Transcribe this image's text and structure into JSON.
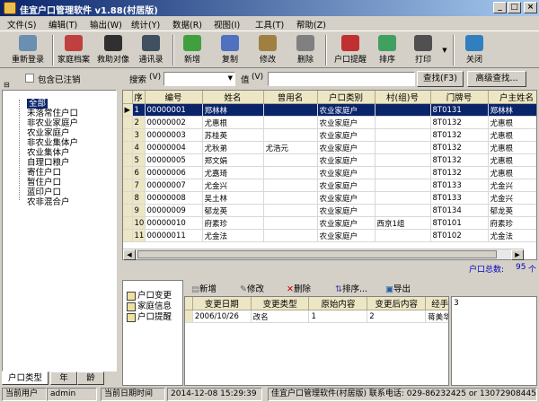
{
  "window": {
    "title": "佳宜户口管理软件 v1.88(村居版)",
    "minimize": "_",
    "maximize": "□",
    "close": "×"
  },
  "menu": [
    "文件(S)",
    "编辑(T)",
    "输出(W)",
    "统计(Y)",
    "数据(R)",
    "视图(I)",
    "工具(T)",
    "帮助(Z)"
  ],
  "toolbar": [
    {
      "label": "重新登录",
      "icon": "relogin-icon",
      "color": "#6a8fb0"
    },
    {
      "label": "家庭档案",
      "icon": "family-file-icon",
      "color": "#c04040"
    },
    {
      "label": "救助对像",
      "icon": "aid-people-icon",
      "color": "#303030"
    },
    {
      "label": "通讯录",
      "icon": "contacts-icon",
      "color": "#405060"
    },
    {
      "label": "新增",
      "icon": "add-icon",
      "color": "#40a040"
    },
    {
      "label": "复制",
      "icon": "copy-icon",
      "color": "#5070c0"
    },
    {
      "label": "修改",
      "icon": "edit-icon",
      "color": "#a08040"
    },
    {
      "label": "删除",
      "icon": "delete-icon",
      "color": "#808080"
    },
    {
      "label": "户口提醒",
      "icon": "reminder-icon",
      "color": "#c03030"
    },
    {
      "label": "排序",
      "icon": "sort-icon",
      "color": "#40a060"
    },
    {
      "label": "打印",
      "icon": "print-icon",
      "color": "#505050"
    },
    {
      "label": "关闭",
      "icon": "close-door-icon",
      "color": "#3080c0"
    }
  ],
  "filter": {
    "include_cancelled": "包含已注销",
    "search_label": "搜索",
    "search_key": "(V)",
    "value_label": "值",
    "value_key": "(V)",
    "find_button": "查找(F3)",
    "advanced_button": "高级查找..."
  },
  "tree": {
    "root": "全部",
    "children": [
      "未落常住户口",
      "非农业家庭户",
      "农业家庭户",
      "非农业集体户",
      "农业集体户",
      "自理口粮户",
      "寄住户口",
      "暂住户口",
      "蓝印户口",
      "农非混合户"
    ]
  },
  "tabs": [
    "户口类型",
    "年",
    "龄"
  ],
  "grid": {
    "columns": [
      "序",
      "编号",
      "姓名",
      "曾用名",
      "户口类别",
      "村(组)号",
      "门牌号",
      "户主姓名"
    ],
    "rows": [
      [
        "1",
        "00000001",
        "郑林林",
        "",
        "农业家庭户",
        "",
        "8T0131",
        "郑林林"
      ],
      [
        "2",
        "00000002",
        "尤惠根",
        "",
        "农业家庭户",
        "",
        "8T0132",
        "尤惠根"
      ],
      [
        "3",
        "00000003",
        "苏桂英",
        "",
        "农业家庭户",
        "",
        "8T0132",
        "尤惠根"
      ],
      [
        "4",
        "00000004",
        "尤秋弟",
        "尤浩元",
        "农业家庭户",
        "",
        "8T0132",
        "尤惠根"
      ],
      [
        "5",
        "00000005",
        "郑文娟",
        "",
        "农业家庭户",
        "",
        "8T0132",
        "尤惠根"
      ],
      [
        "6",
        "00000006",
        "尤嘉琦",
        "",
        "农业家庭户",
        "",
        "8T0132",
        "尤惠根"
      ],
      [
        "7",
        "00000007",
        "尤金兴",
        "",
        "农业家庭户",
        "",
        "8T0133",
        "尤金兴"
      ],
      [
        "8",
        "00000008",
        "吴土林",
        "",
        "农业家庭户",
        "",
        "8T0133",
        "尤金兴"
      ],
      [
        "9",
        "00000009",
        "郁龙英",
        "",
        "农业家庭户",
        "",
        "8T0134",
        "郁龙英"
      ],
      [
        "10",
        "00000010",
        "府素珍",
        "",
        "农业家庭户",
        "西京1组",
        "8T0101",
        "府素珍"
      ],
      [
        "11",
        "00000011",
        "尤金法",
        "",
        "农业家庭户",
        "",
        "8T0102",
        "尤金法"
      ]
    ]
  },
  "count": {
    "label": "户口总数:",
    "value": "95",
    "unit": "个"
  },
  "lower_nav": [
    {
      "label": "户口变更",
      "icon": "change-icon"
    },
    {
      "label": "家庭信息",
      "icon": "family-info-icon"
    },
    {
      "label": "户口提醒",
      "icon": "reminder-small-icon"
    }
  ],
  "detail_toolbar": [
    "新增",
    "修改",
    "删除",
    "排序...",
    "导出"
  ],
  "detail_grid": {
    "columns": [
      "变更日期",
      "变更类型",
      "原始内容",
      "变更后内容",
      "经手人"
    ],
    "rows": [
      [
        "2006/10/26",
        "改名",
        "1",
        "2",
        "蒋美华"
      ]
    ]
  },
  "memo_text": "3",
  "status": {
    "user_label": "当前用户",
    "user": "admin",
    "datetime_label": "当前日期时间",
    "datetime": "2014-12-08 15:29:39",
    "info": "佳宜户口管理软件(村居版) 联系电话: 029-86232425 or 13072908445"
  }
}
